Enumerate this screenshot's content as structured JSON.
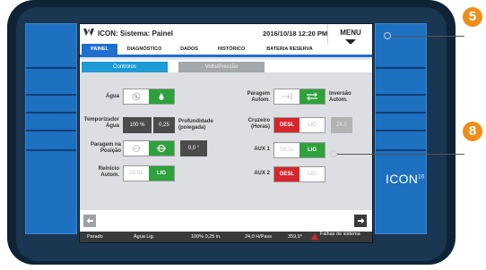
{
  "titlebar": {
    "title": "ICON: Sistema: Painel",
    "datetime": "2016/10/18 12:20 PM",
    "menu_label": "MENU"
  },
  "tabs": [
    "PAINEL",
    "DIAGNÓSTICO",
    "DADOS",
    "HISTÓRICO",
    "BATERIA RESERVA"
  ],
  "active_tab": "PAINEL",
  "subtabs": {
    "controls": "Controlos",
    "volts": "Volts/Pressão"
  },
  "panel": {
    "agua_label": "Água",
    "temporizador_label": "Temporizador Água",
    "temporizador_percent": "100 %",
    "temporizador_depth": "0,25",
    "profundidade_label": "Profundidade (polegada)",
    "paragem_posicao_label": "Paragem na Posição",
    "paragem_posicao_value": "0,0 °",
    "reinicio_label": "Reinício Autom.",
    "reinicio_off": "DESL",
    "reinicio_on": "LIG",
    "paragem_autom_label": "Paragem Autom.",
    "inversao_label": "Inversão Autom.",
    "cruzeiro_label": "Cruzeiro (Horas)",
    "cruzeiro_off": "DESL",
    "cruzeiro_on": "LIG",
    "cruzeiro_value": "24,0",
    "aux1_label": "AUX 1",
    "aux1_off": "DESL",
    "aux1_on": "LIG",
    "aux2_label": "AUX 2",
    "aux2_off": "DESL",
    "aux2_on": "LIG"
  },
  "status": {
    "state": "Parado",
    "water": "Água Lig.",
    "percent_depth": "100%  0,25 in.",
    "speed": "24,0 H/Pass",
    "angle": "359,9°",
    "failures": "Falhas do sistema"
  },
  "brand": {
    "name": "ICON",
    "super": "10"
  },
  "callouts": [
    "5",
    "8"
  ],
  "colors": {
    "accent_blue": "#1e6fd0",
    "on_green": "#2ea13c",
    "off_red": "#d6252b",
    "badge_orange": "#f08d1a"
  }
}
